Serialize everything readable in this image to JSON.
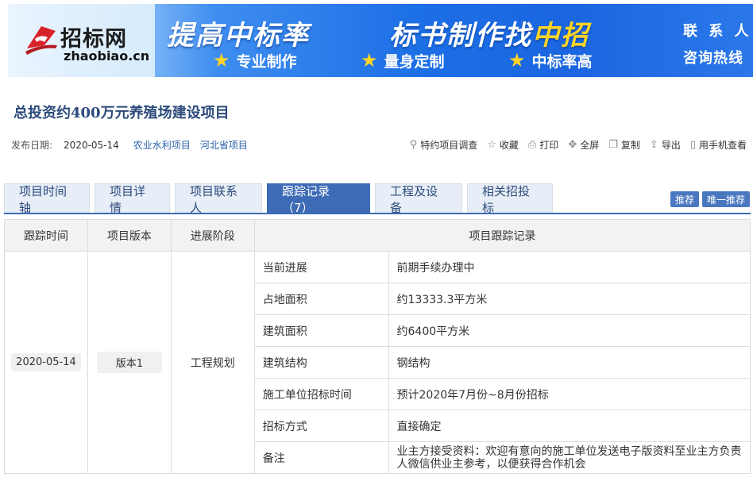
{
  "banner": {
    "logo_cn": "招标网",
    "logo_en": "zhaobiao.cn",
    "slogan1": "提高中标率",
    "slogan2_a": "标书制作找",
    "slogan2_b": "中招",
    "features": [
      "专业制作",
      "量身定制",
      "中标率高"
    ],
    "contact1": "联 系 人",
    "contact2": "咨询热线"
  },
  "title": "总投资约400万元养殖场建设项目",
  "meta": {
    "date_label": "发布日期:",
    "date": "2020-05-14",
    "tags": [
      "农业水利项目",
      "河北省项目"
    ]
  },
  "tools": [
    {
      "icon": "search-icon",
      "glyph": "⚲",
      "label": "特约项目调查"
    },
    {
      "icon": "star-icon",
      "glyph": "☆",
      "label": "收藏"
    },
    {
      "icon": "print-icon",
      "glyph": "⎙",
      "label": "打印"
    },
    {
      "icon": "fullscreen-icon",
      "glyph": "✥",
      "label": "全屏"
    },
    {
      "icon": "copy-icon",
      "glyph": "❐",
      "label": "复制"
    },
    {
      "icon": "export-icon",
      "glyph": "⇪",
      "label": "导出"
    },
    {
      "icon": "phone-icon",
      "glyph": "▯",
      "label": "用手机查看"
    }
  ],
  "tabs": [
    "项目时间轴",
    "项目详情",
    "项目联系人",
    "跟踪记录（7）",
    "工程及设备",
    "相关招投标"
  ],
  "right_buttons": [
    "推荐",
    "唯一推荐"
  ],
  "table": {
    "headers": [
      "跟踪时间",
      "项目版本",
      "进展阶段",
      "项目跟踪记录"
    ],
    "date": "2020-05-14",
    "version": "版本1",
    "stage": "工程规划",
    "rows": [
      {
        "k": "当前进展",
        "v": "前期手续办理中"
      },
      {
        "k": "占地面积",
        "v": "约13333.3平方米"
      },
      {
        "k": "建筑面积",
        "v": "约6400平方米"
      },
      {
        "k": "建筑结构",
        "v": "钢结构"
      },
      {
        "k": "施工单位招标时间",
        "v": "预计2020年7月份~8月份招标"
      },
      {
        "k": "招标方式",
        "v": "直接确定"
      },
      {
        "k": "备注",
        "v": "业主方接受资料：欢迎有意向的施工单位发送电子版资料至业主方负责人微信供业主参考，以便获得合作机会"
      }
    ]
  }
}
